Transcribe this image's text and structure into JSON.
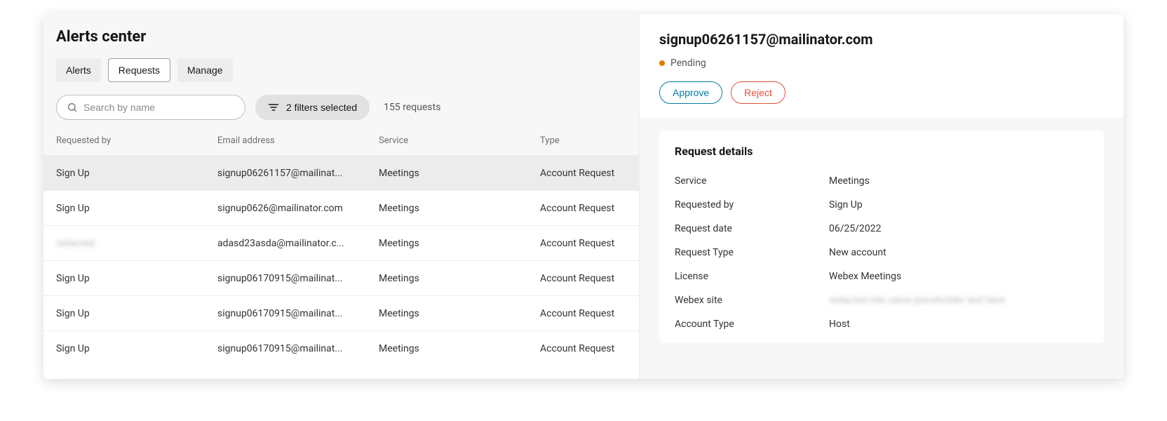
{
  "page_title": "Alerts center",
  "tabs": [
    {
      "label": "Alerts",
      "active": false
    },
    {
      "label": "Requests",
      "active": true
    },
    {
      "label": "Manage",
      "active": false
    }
  ],
  "search": {
    "placeholder": "Search by name",
    "value": ""
  },
  "filter_chip": {
    "label": "2 filters selected"
  },
  "count_label": "155 requests",
  "columns": [
    "Requested by",
    "Email address",
    "Service",
    "Type"
  ],
  "rows": [
    {
      "requested_by": "Sign Up",
      "email": "signup06261157@mailinat...",
      "service": "Meetings",
      "type": "Account Request",
      "selected": true,
      "blur_requested_by": false
    },
    {
      "requested_by": "Sign Up",
      "email": "signup0626@mailinator.com",
      "service": "Meetings",
      "type": "Account Request",
      "selected": false,
      "blur_requested_by": false
    },
    {
      "requested_by": "redacted",
      "email": "adasd23asda@mailinator.c...",
      "service": "Meetings",
      "type": "Account Request",
      "selected": false,
      "blur_requested_by": true
    },
    {
      "requested_by": "Sign Up",
      "email": "signup06170915@mailinat...",
      "service": "Meetings",
      "type": "Account Request",
      "selected": false,
      "blur_requested_by": false
    },
    {
      "requested_by": "Sign Up",
      "email": "signup06170915@mailinat...",
      "service": "Meetings",
      "type": "Account Request",
      "selected": false,
      "blur_requested_by": false
    },
    {
      "requested_by": "Sign Up",
      "email": "signup06170915@mailinat...",
      "service": "Meetings",
      "type": "Account Request",
      "selected": false,
      "blur_requested_by": false
    }
  ],
  "detail": {
    "title": "signup06261157@mailinator.com",
    "status_label": "Pending",
    "status_color": "#e07b00",
    "approve_label": "Approve",
    "reject_label": "Reject",
    "section_title": "Request details",
    "fields": [
      {
        "k": "Service",
        "v": "Meetings",
        "blur": false
      },
      {
        "k": "Requested by",
        "v": "Sign Up",
        "blur": false
      },
      {
        "k": "Request date",
        "v": "06/25/2022",
        "blur": false
      },
      {
        "k": "Request Type",
        "v": "New account",
        "blur": false
      },
      {
        "k": "License",
        "v": "Webex Meetings",
        "blur": false
      },
      {
        "k": "Webex site",
        "v": "redacted site value placeholder text here",
        "blur": true
      },
      {
        "k": "Account Type",
        "v": "Host",
        "blur": false
      }
    ]
  }
}
